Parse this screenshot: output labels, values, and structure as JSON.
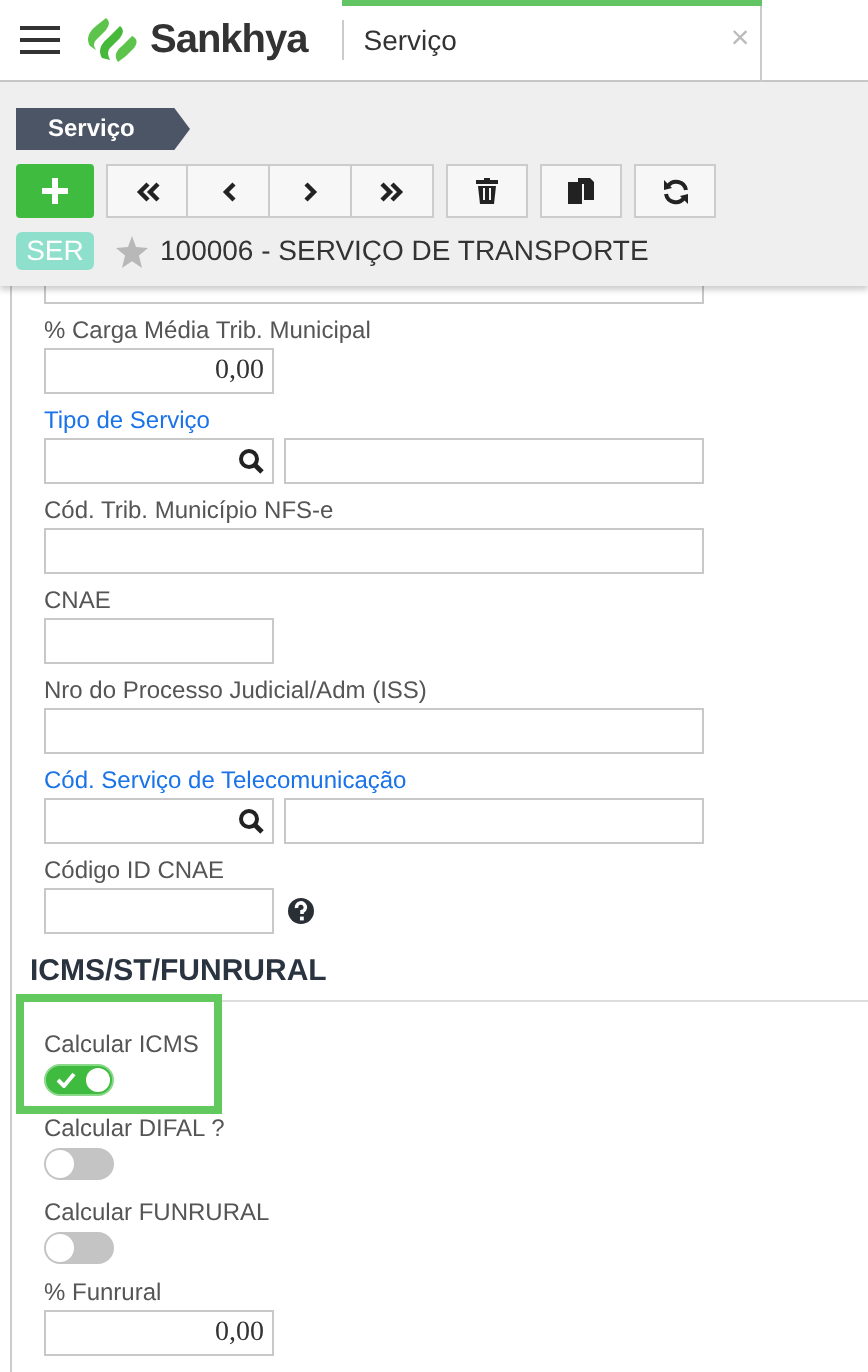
{
  "header": {
    "app_name": "Sankhya",
    "tab": {
      "label": "Serviço",
      "close": "×",
      "selected": true
    }
  },
  "breadcrumb": "Serviço",
  "record": {
    "badge": "SER",
    "favorite": false,
    "title": "100006 - SERVIÇO DE TRANSPORTE"
  },
  "fields": [
    {
      "kind": "cut"
    },
    {
      "kind": "number",
      "label": "% Carga Média Trib. Municipal",
      "value": "0,00"
    },
    {
      "kind": "lookup",
      "label": "Tipo de Serviço"
    },
    {
      "kind": "wide",
      "label": "Cód. Trib. Município NFS-e"
    },
    {
      "kind": "narrow",
      "label": "CNAE"
    },
    {
      "kind": "wide",
      "label": "Nro do Processo Judicial/Adm (ISS)"
    },
    {
      "kind": "lookup",
      "label": "Cód. Serviço de Telecomunicação"
    },
    {
      "kind": "help",
      "label": "Código ID CNAE"
    },
    {
      "kind": "section",
      "label": "ICMS/ST/FUNRURAL"
    },
    {
      "kind": "toggle",
      "label": "Calcular ICMS",
      "on": true,
      "highlighted": true
    },
    {
      "kind": "toggle",
      "label": "Calcular DIFAL ?",
      "on": false,
      "highlighted": false
    },
    {
      "kind": "toggle",
      "label": "Calcular FUNRURAL",
      "on": false,
      "highlighted": false
    },
    {
      "kind": "number",
      "label": "% Funrural",
      "value": "0,00"
    }
  ]
}
